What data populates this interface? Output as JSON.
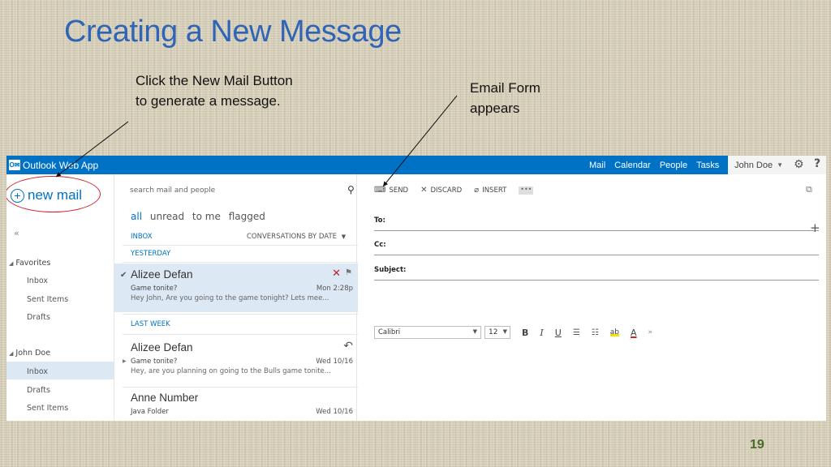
{
  "slide": {
    "title": "Creating a New Message",
    "callout_left": "Click the New Mail Button to generate a message.",
    "callout_right": "Email Form appears",
    "number": "19"
  },
  "app": {
    "brand": "Outlook Web App",
    "nav": [
      "Mail",
      "Calendar",
      "People",
      "Tasks"
    ],
    "user": "John Doe",
    "accent": "#0072c6"
  },
  "leftnav": {
    "new_mail": "new mail",
    "collapse": "«",
    "favorites": {
      "label": "Favorites",
      "items": [
        "Inbox",
        "Sent Items",
        "Drafts"
      ]
    },
    "account": {
      "label": "John Doe",
      "items": [
        "Inbox",
        "Drafts",
        "Sent Items"
      ],
      "selected": "Inbox"
    }
  },
  "msglist": {
    "search_placeholder": "search mail and people",
    "filters": [
      "all",
      "unread",
      "to me",
      "flagged"
    ],
    "folder": "INBOX",
    "sort": "CONVERSATIONS BY DATE",
    "groups": [
      "YESTERDAY",
      "LAST WEEK"
    ],
    "messages": [
      {
        "from": "Alizee Defan",
        "subject": "Game tonite?",
        "preview": "Hey John, Are you going to the game tonight? Lets mee...",
        "date": "Mon 2:28p"
      },
      {
        "from": "Alizee Defan",
        "subject": "Game tonite?",
        "preview": "Hey, are you planning on going to the Bulls game tonite...",
        "date": "Wed 10/16"
      },
      {
        "from": "Anne Number",
        "subject": "Java Folder",
        "preview": "",
        "date": "Wed 10/16"
      }
    ]
  },
  "compose": {
    "toolbar": {
      "send": "SEND",
      "discard": "DISCARD",
      "insert": "INSERT",
      "more": "•••"
    },
    "fields": {
      "to": "To:",
      "cc": "Cc:",
      "subject": "Subject:"
    },
    "format": {
      "font": "Calibri",
      "size": "12",
      "bold": "B",
      "italic": "I",
      "underline": "U",
      "bullets": "☰",
      "numbering": "☷",
      "highlight": "ab",
      "font_color": "A",
      "more": "»"
    }
  }
}
